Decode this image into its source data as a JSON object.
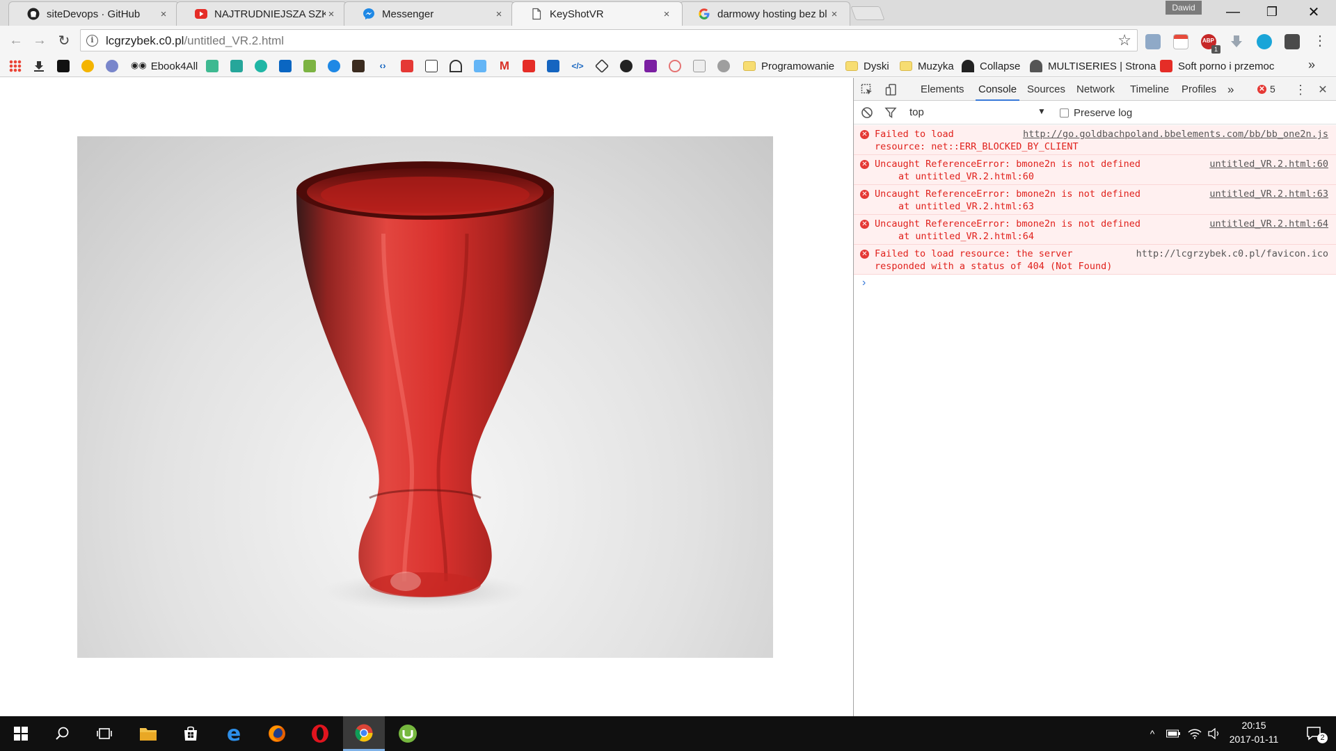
{
  "window": {
    "profile_name": "Dawid",
    "minimize_icon": "—",
    "maximize_icon": "❐",
    "close_icon": "✕"
  },
  "tabs": [
    {
      "title": "siteDevops · GitHub",
      "icon": "github-icon",
      "close": "×"
    },
    {
      "title": "NAJTRUDNIEJSZA SZKOŁ",
      "icon": "youtube-icon",
      "close": "×"
    },
    {
      "title": "Messenger",
      "icon": "messenger-icon",
      "close": "×"
    },
    {
      "title": "KeyShotVR",
      "icon": "document-icon",
      "close": "×"
    },
    {
      "title": "darmowy hosting bez bl",
      "icon": "google-icon",
      "close": "×"
    }
  ],
  "toolbar": {
    "back_icon": "←",
    "forward_icon": "→",
    "reload_icon": "↻",
    "url_host": "lcgrzybek.c0.pl",
    "url_path": "/untitled_VR.2.html",
    "star_icon": "☆",
    "adblock_badge": "1"
  },
  "bookmarks": {
    "items": [
      {
        "label": "Ebook4All"
      },
      {
        "label": "Programowanie"
      },
      {
        "label": "Dyski"
      },
      {
        "label": "Muzyka"
      },
      {
        "label": "Collapse"
      },
      {
        "label": "MULTISERIES | Strona"
      },
      {
        "label": "Soft porno i przemoc"
      }
    ],
    "more": "»"
  },
  "devtools": {
    "tabs": [
      "Elements",
      "Console",
      "Sources",
      "Network",
      "Timeline",
      "Profiles"
    ],
    "active_tab": "Console",
    "more": "»",
    "error_count": "5",
    "menu_icon": "⋮",
    "close_icon": "✕",
    "filter": {
      "context": "top",
      "preserve_log": "Preserve log"
    },
    "messages": [
      {
        "line1": "Failed to load",
        "line2": "resource: net::ERR_BLOCKED_BY_CLIENT",
        "source": "http://go.goldbachpoland.bbelements.com/bb/bb_one2n.js"
      },
      {
        "line1": "Uncaught ReferenceError: bmone2n is not defined",
        "line2": "at untitled_VR.2.html:60",
        "source": "untitled_VR.2.html:60"
      },
      {
        "line1": "Uncaught ReferenceError: bmone2n is not defined",
        "line2": "at untitled_VR.2.html:63",
        "source": "untitled_VR.2.html:63"
      },
      {
        "line1": "Uncaught ReferenceError: bmone2n is not defined",
        "line2": "at untitled_VR.2.html:64",
        "source": "untitled_VR.2.html:64"
      },
      {
        "line1": "Failed to load resource: the server",
        "line2": "responded with a status of 404 (Not Found)",
        "source": "http://lcgrzybek.c0.pl/favicon.ico"
      }
    ],
    "prompt": "›"
  },
  "taskbar": {
    "clock_time": "20:15",
    "clock_date": "2017-01-11",
    "notification_count": "2"
  },
  "colors": {
    "vase_red": "#d8231f",
    "error_red": "#e0211c",
    "error_bg": "#fff0f0",
    "devtools_accent": "#3879d9"
  }
}
